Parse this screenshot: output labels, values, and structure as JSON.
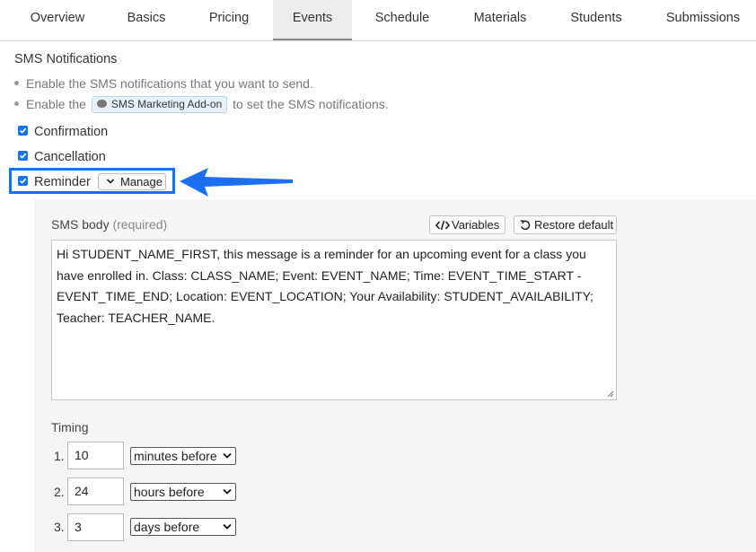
{
  "tabs": [
    "Overview",
    "Basics",
    "Pricing",
    "Events",
    "Schedule",
    "Materials",
    "Students",
    "Submissions"
  ],
  "section_title": "SMS Notifications",
  "bullets": {
    "line1": "Enable the SMS notifications that you want to send.",
    "line2_prefix": "Enable the",
    "line2_pill": "SMS Marketing Add-on",
    "line2_suffix": "to set the SMS notifications."
  },
  "checkboxes": {
    "confirmation": "Confirmation",
    "cancellation": "Cancellation",
    "reminder": "Reminder"
  },
  "manage_label": "Manage",
  "sms_body": {
    "label": "SMS body",
    "required": "(required)",
    "variables_label": "Variables",
    "restore_label": "Restore default",
    "text": "Hi STUDENT_NAME_FIRST, this message is a reminder for an upcoming event for a class you have enrolled in. Class: CLASS_NAME; Event: EVENT_NAME; Time: EVENT_TIME_START - EVENT_TIME_END; Location: EVENT_LOCATION; Your Availability: STUDENT_AVAILABILITY; Teacher: TEACHER_NAME."
  },
  "timing": {
    "label": "Timing",
    "rows": [
      {
        "num": "1.",
        "value": "10",
        "unit": "minutes before"
      },
      {
        "num": "2.",
        "value": "24",
        "unit": "hours before"
      },
      {
        "num": "3.",
        "value": "3",
        "unit": "days before"
      }
    ]
  },
  "colors": {
    "accent": "#1d6ff2",
    "checkbox": "#1a73e8",
    "panel": "#f5f5f5"
  }
}
